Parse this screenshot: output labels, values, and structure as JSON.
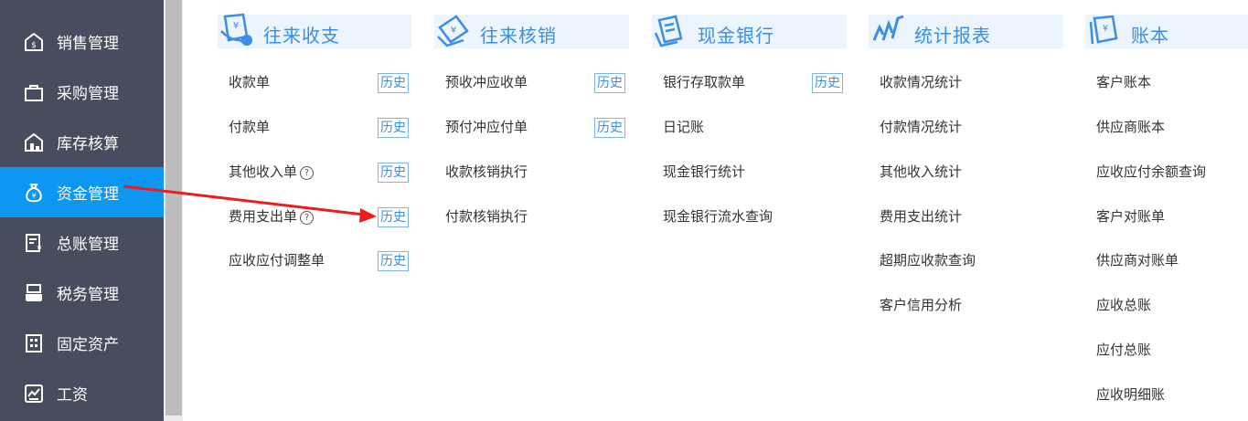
{
  "sidebar": {
    "items": [
      {
        "label": "销售管理",
        "icon": "sales-icon",
        "active": false
      },
      {
        "label": "采购管理",
        "icon": "shopping-bag-icon",
        "active": false
      },
      {
        "label": "库存核算",
        "icon": "warehouse-icon",
        "active": false
      },
      {
        "label": "资金管理",
        "icon": "money-bag-icon",
        "active": true
      },
      {
        "label": "总账管理",
        "icon": "ledger-icon",
        "active": false
      },
      {
        "label": "税务管理",
        "icon": "tax-icon",
        "active": false
      },
      {
        "label": "固定资产",
        "icon": "building-icon",
        "active": false
      },
      {
        "label": "工资",
        "icon": "salary-chart-icon",
        "active": false
      }
    ],
    "active_color": "#0d96f2",
    "background": "#474d5e"
  },
  "history_label": "历史",
  "help_glyph": "?",
  "columns": [
    {
      "title": "往来收支",
      "icon": "receipt-yen-icon",
      "entries": [
        {
          "label": "收款单",
          "history": true,
          "help": false
        },
        {
          "label": "付款单",
          "history": true,
          "help": false
        },
        {
          "label": "其他收入单",
          "history": true,
          "help": true
        },
        {
          "label": "费用支出单",
          "history": true,
          "help": true
        },
        {
          "label": "应收应付调整单",
          "history": true,
          "help": false
        }
      ]
    },
    {
      "title": "往来核销",
      "icon": "voucher-yen-icon",
      "entries": [
        {
          "label": "预收冲应收单",
          "history": true,
          "help": false
        },
        {
          "label": "预付冲应付单",
          "history": true,
          "help": false
        },
        {
          "label": "收款核销执行",
          "history": false,
          "help": false
        },
        {
          "label": "付款核销执行",
          "history": false,
          "help": false
        }
      ]
    },
    {
      "title": "现金银行",
      "icon": "bank-card-icon",
      "entries": [
        {
          "label": "银行存取款单",
          "history": true,
          "help": false
        },
        {
          "label": "日记账",
          "history": false,
          "help": false
        },
        {
          "label": "现金银行统计",
          "history": false,
          "help": false
        },
        {
          "label": "现金银行流水查询",
          "history": false,
          "help": false
        }
      ]
    },
    {
      "title": "统计报表",
      "icon": "report-chart-icon",
      "entries": [
        {
          "label": "收款情况统计",
          "history": false,
          "help": false
        },
        {
          "label": "付款情况统计",
          "history": false,
          "help": false
        },
        {
          "label": "其他收入统计",
          "history": false,
          "help": false
        },
        {
          "label": "费用支出统计",
          "history": false,
          "help": false
        },
        {
          "label": "超期应收款查询",
          "history": false,
          "help": false
        },
        {
          "label": "客户信用分析",
          "history": false,
          "help": false
        }
      ]
    },
    {
      "title": "账本",
      "icon": "account-book-icon",
      "entries": [
        {
          "label": "客户账本",
          "history": false,
          "help": false
        },
        {
          "label": "供应商账本",
          "history": false,
          "help": false
        },
        {
          "label": "应收应付余额查询",
          "history": false,
          "help": false
        },
        {
          "label": "客户对账单",
          "history": false,
          "help": false
        },
        {
          "label": "供应商对账单",
          "history": false,
          "help": false
        },
        {
          "label": "应收总账",
          "history": false,
          "help": false
        },
        {
          "label": "应付总账",
          "history": false,
          "help": false
        },
        {
          "label": "应收明细账",
          "history": false,
          "help": false
        }
      ]
    }
  ],
  "annotation_color": "#ee1c1c"
}
